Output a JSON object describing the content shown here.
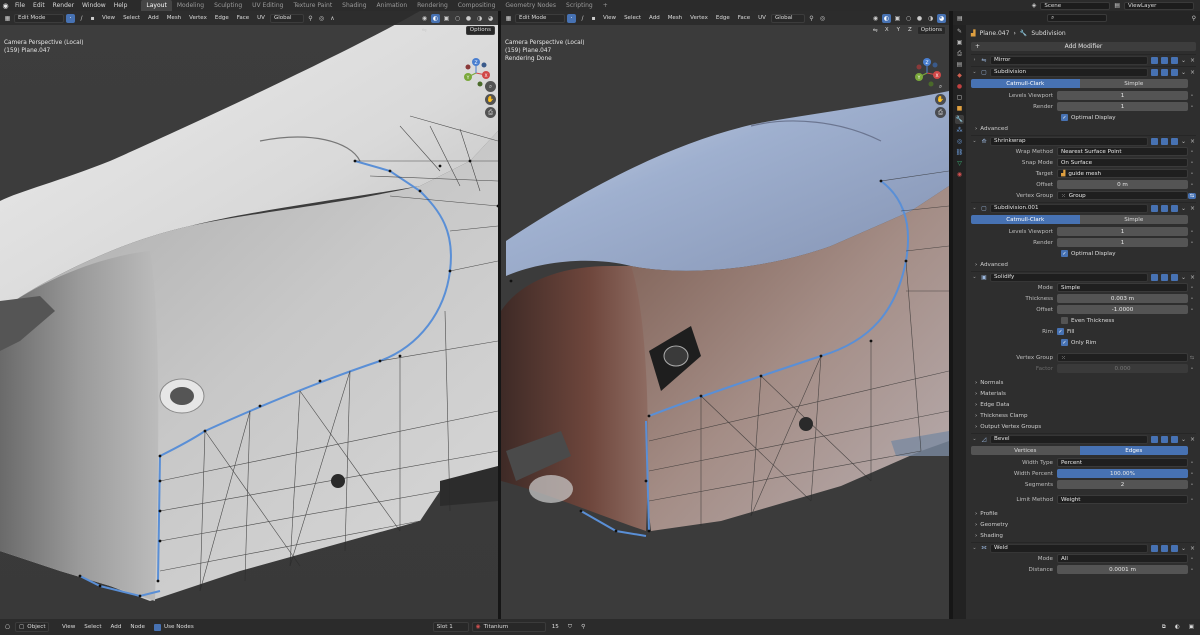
{
  "topbar": {
    "menus": [
      "File",
      "Edit",
      "Render",
      "Window",
      "Help"
    ],
    "workspaces": [
      "Layout",
      "Modeling",
      "Sculpting",
      "UV Editing",
      "Texture Paint",
      "Shading",
      "Animation",
      "Rendering",
      "Compositing",
      "Geometry Nodes",
      "Scripting"
    ],
    "active_workspace": "Layout",
    "scene": "Scene",
    "view_layer": "ViewLayer"
  },
  "viewport_left": {
    "mode": "Edit Mode",
    "menus": [
      "View",
      "Select",
      "Add",
      "Mesh",
      "Vertex",
      "Edge",
      "Face",
      "UV"
    ],
    "transform_orientation": "Global",
    "axes": [
      "X",
      "Y",
      "Z"
    ],
    "options": "Options",
    "info_line1": "Camera Perspective (Local)",
    "info_line2": "(159) Plane.047"
  },
  "viewport_right": {
    "mode": "Edit Mode",
    "menus": [
      "View",
      "Select",
      "Add",
      "Mesh",
      "Vertex",
      "Edge",
      "Face",
      "UV"
    ],
    "transform_orientation": "Global",
    "axes": [
      "X",
      "Y",
      "Z"
    ],
    "options": "Options",
    "info_line1": "Camera Perspective (Local)",
    "info_line2": "(159) Plane.047",
    "info_line3": "Rendering Done"
  },
  "gizmo": {
    "x": "X",
    "y": "Y",
    "z": "Z"
  },
  "properties": {
    "breadcrumb_object": "Plane.047",
    "breadcrumb_modifier": "Subdivision",
    "add_modifier": "Add Modifier",
    "mirror": {
      "name": "Mirror"
    },
    "subdivision": {
      "name": "Subdivision",
      "mode_a": "Catmull-Clark",
      "mode_b": "Simple",
      "levels_viewport_label": "Levels Viewport",
      "levels_viewport": "1",
      "render_label": "Render",
      "render": "1",
      "optimal_display": "Optimal Display",
      "advanced": "Advanced"
    },
    "shrinkwrap": {
      "name": "Shrinkwrap",
      "wrap_method_label": "Wrap Method",
      "wrap_method": "Nearest Surface Point",
      "snap_mode_label": "Snap Mode",
      "snap_mode": "On Surface",
      "target_label": "Target",
      "target": "guide mesh",
      "offset_label": "Offset",
      "offset": "0 m",
      "vertex_group_label": "Vertex Group",
      "vertex_group": "Group"
    },
    "subdivision001": {
      "name": "Subdivision.001",
      "mode_a": "Catmull-Clark",
      "mode_b": "Simple",
      "levels_viewport_label": "Levels Viewport",
      "levels_viewport": "1",
      "render_label": "Render",
      "render": "1",
      "optimal_display": "Optimal Display",
      "advanced": "Advanced"
    },
    "solidify": {
      "name": "Solidify",
      "mode_label": "Mode",
      "mode": "Simple",
      "thickness_label": "Thickness",
      "thickness": "0.003 m",
      "offset_label": "Offset",
      "offset": "-1.0000",
      "even_thickness": "Even Thickness",
      "rim_label": "Rim",
      "fill": "Fill",
      "only_rim": "Only Rim",
      "vertex_group_label": "Vertex Group",
      "factor_label": "Factor",
      "factor": "0.000",
      "subpanels": [
        "Normals",
        "Materials",
        "Edge Data",
        "Thickness Clamp",
        "Output Vertex Groups"
      ]
    },
    "bevel": {
      "name": "Bevel",
      "mode_a": "Vertices",
      "mode_b": "Edges",
      "width_type_label": "Width Type",
      "width_type": "Percent",
      "width_percent_label": "Width Percent",
      "width_percent": "100.00%",
      "width_percent_fraction": 1.0,
      "segments_label": "Segments",
      "segments": "2",
      "limit_method_label": "Limit Method",
      "limit_method": "Weight",
      "subpanels": [
        "Profile",
        "Geometry",
        "Shading"
      ]
    },
    "weld": {
      "name": "Weld",
      "mode_label": "Mode",
      "mode": "All",
      "distance_label": "Distance",
      "distance": "0.0001 m"
    }
  },
  "statusbar": {
    "mode": "Object",
    "menus": [
      "View",
      "Select",
      "Add",
      "Node"
    ],
    "use_nodes": "Use Nodes",
    "slot": "Slot 1",
    "material": "Titanium",
    "users": "15"
  }
}
